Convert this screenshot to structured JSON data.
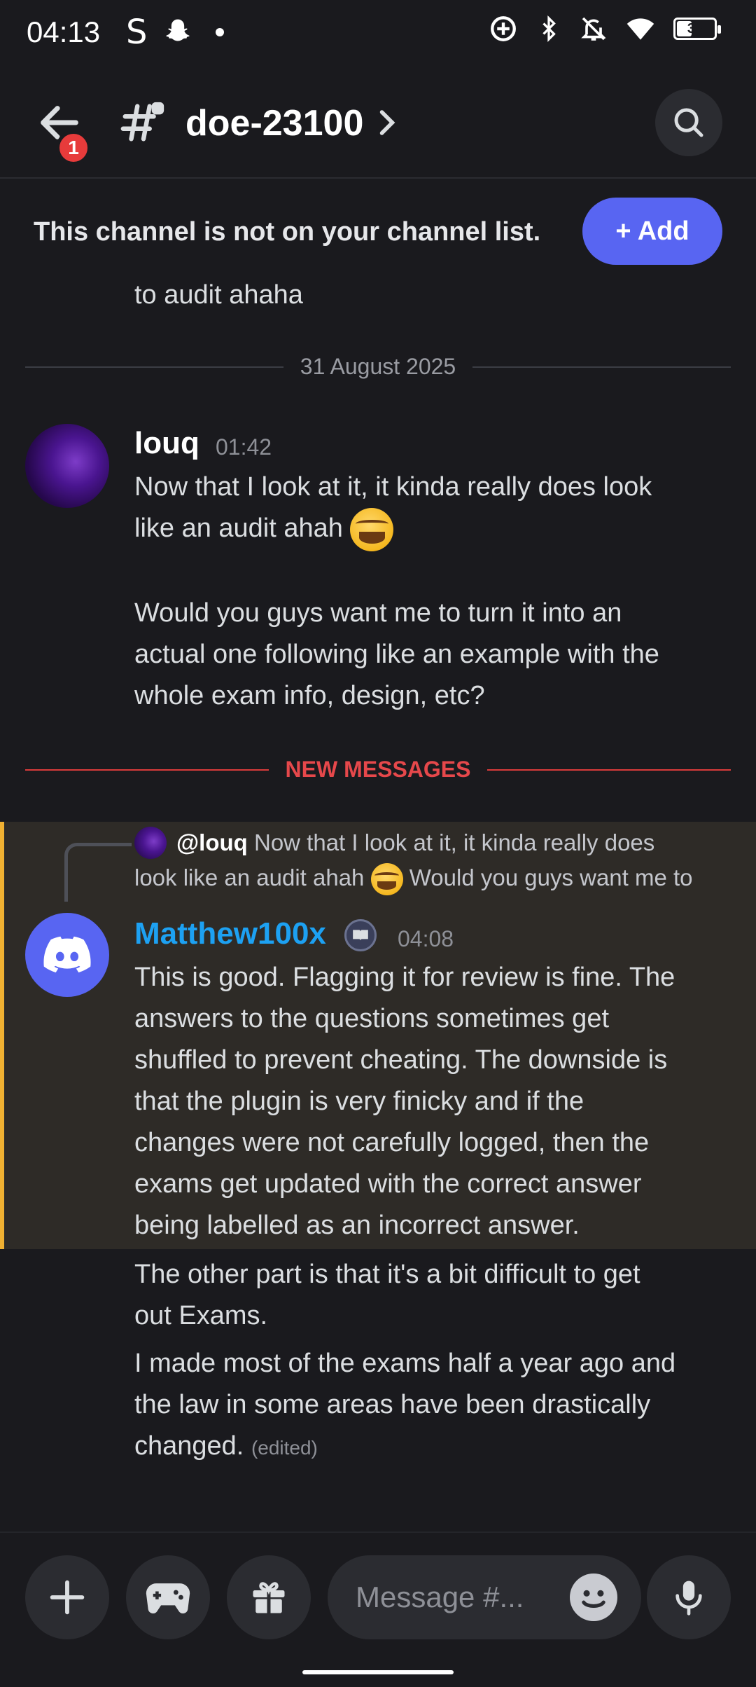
{
  "status_bar": {
    "time": "04:13",
    "battery": "38",
    "left_icons": [
      "s-app-icon",
      "snapchat-icon",
      "dot-icon"
    ],
    "right_icons": [
      "data-saver-icon",
      "bluetooth-icon",
      "bell-off-icon",
      "wifi-icon",
      "battery-icon"
    ]
  },
  "header": {
    "channel_name": "doe-23100",
    "unread_badge": "1"
  },
  "notice": {
    "text": "This channel is not on your channel list.",
    "add_label": "+ Add"
  },
  "messages": {
    "previous_tail": "to audit ahaha",
    "date_divider": "31 August 2025",
    "louq": {
      "username": "louq",
      "username_color": "#ffffff",
      "time": "01:42",
      "line1": "Now that I look at it, it kinda really does look",
      "line2": "like an audit ahah",
      "line3": "Would you guys want me to turn it into an",
      "line4": "actual one following like an example with the",
      "line5": "whole exam info, design, etc?"
    },
    "new_messages_label": "NEW MESSAGES",
    "reply": {
      "mention": "@louq",
      "line1": "Now that I look at it, it kinda really does",
      "line2a": "look like an audit ahah",
      "line2b": "Would you guys want me to"
    },
    "matthew": {
      "username": "Matthew100x",
      "username_color": "#1da1f2",
      "time": "04:08",
      "paragraph1": [
        "This is good. Flagging it for review is fine. The",
        "answers to the questions sometimes get",
        "shuffled to prevent cheating. The downside is",
        "that the plugin is very finicky and if the",
        "changes were not carefully logged, then the",
        "exams get updated with the correct answer",
        "being labelled as an incorrect answer."
      ],
      "paragraph2": [
        "The other part is that it's a bit difficult to get",
        "out Exams."
      ],
      "paragraph3": [
        "I made most of the exams half a year ago and",
        "the law in some areas have been drastically",
        "changed."
      ],
      "edited_label": "(edited)"
    }
  },
  "composer": {
    "placeholder": "Message #..."
  },
  "colors": {
    "accent": "#5865f2",
    "highlight_border": "#f0b132",
    "new_messages": "#e6484b",
    "badge": "#e73b3b"
  }
}
